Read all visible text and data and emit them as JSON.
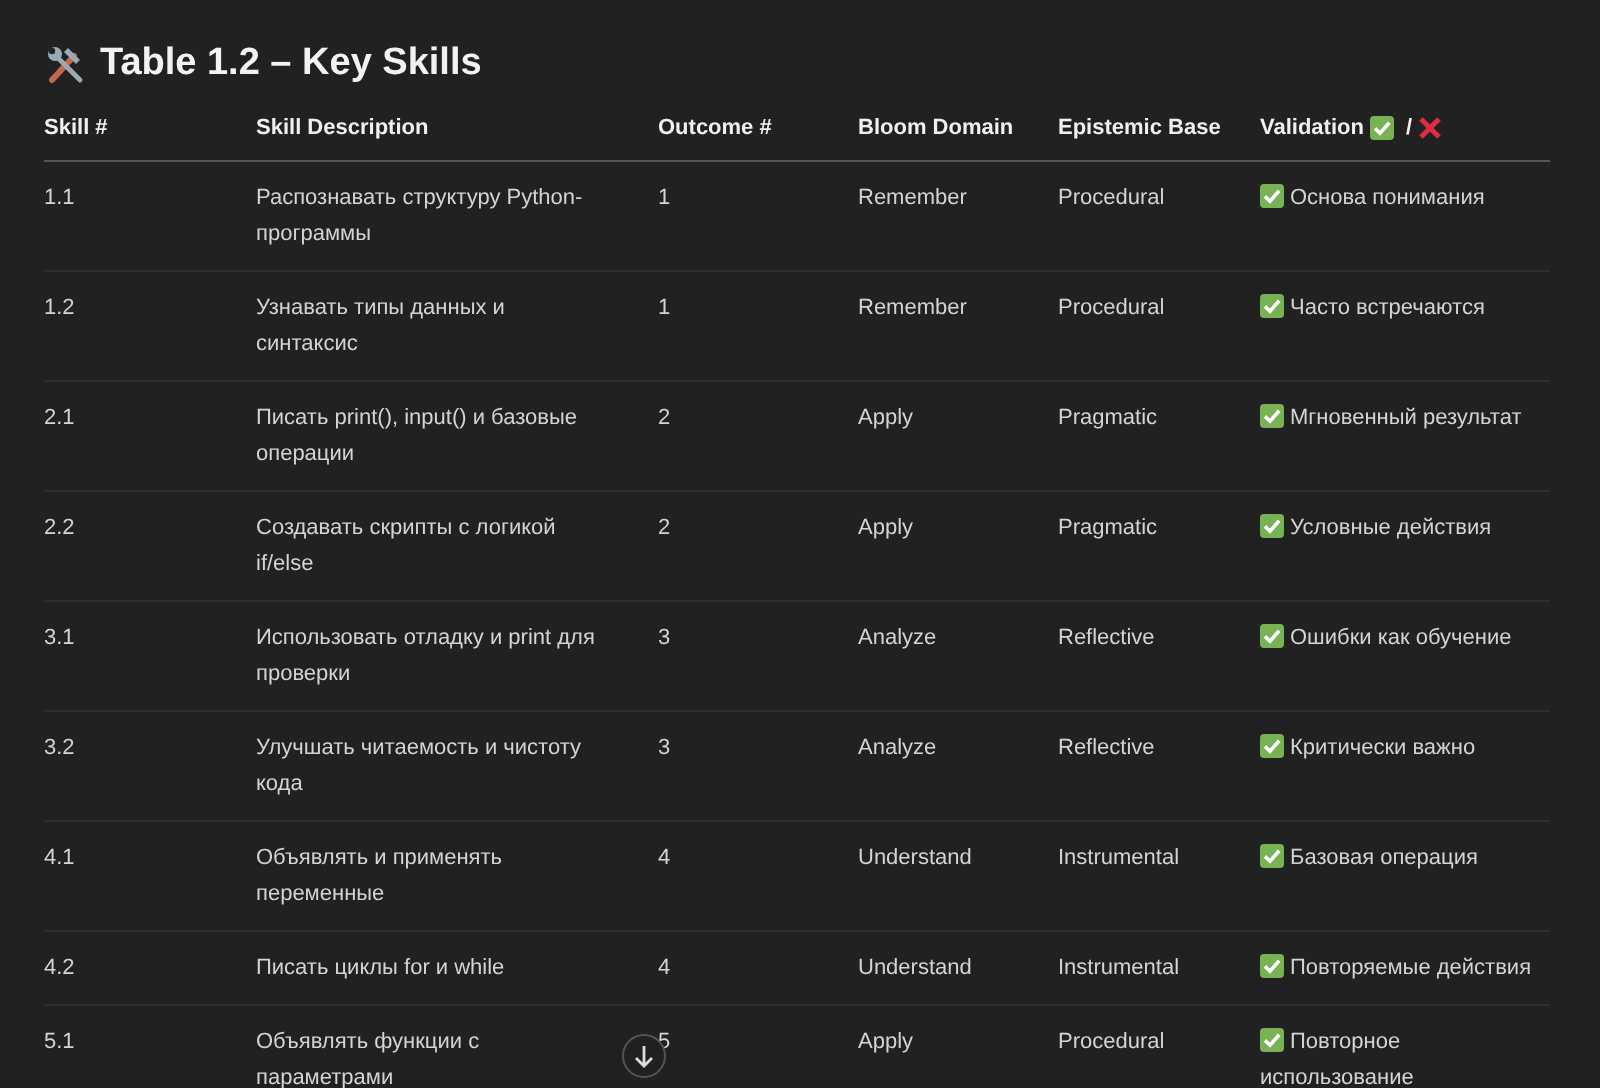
{
  "title": "Table 1.2 – Key Skills",
  "columns": [
    "Skill #",
    "Skill Description",
    "Outcome #",
    "Bloom Domain",
    "Epistemic Base",
    "Validation"
  ],
  "validation_header": {
    "separator": "/"
  },
  "rows": [
    {
      "skill": "1.1",
      "description": "Распознавать структуру Python-программы",
      "outcome": "1",
      "bloom": "Remember",
      "epistemic": "Procedural",
      "valid": true,
      "validation": "Основа понимания"
    },
    {
      "skill": "1.2",
      "description": "Узнавать типы данных и синтаксис",
      "outcome": "1",
      "bloom": "Remember",
      "epistemic": "Procedural",
      "valid": true,
      "validation": "Часто встречаются"
    },
    {
      "skill": "2.1",
      "description": "Писать print(), input() и базовые операции",
      "outcome": "2",
      "bloom": "Apply",
      "epistemic": "Pragmatic",
      "valid": true,
      "validation": "Мгновенный результат"
    },
    {
      "skill": "2.2",
      "description": "Создавать скрипты с логикой if/else",
      "outcome": "2",
      "bloom": "Apply",
      "epistemic": "Pragmatic",
      "valid": true,
      "validation": "Условные действия"
    },
    {
      "skill": "3.1",
      "description": "Использовать отладку и print для проверки",
      "outcome": "3",
      "bloom": "Analyze",
      "epistemic": "Reflective",
      "valid": true,
      "validation": "Ошибки как обучение"
    },
    {
      "skill": "3.2",
      "description": "Улучшать читаемость и чистоту кода",
      "outcome": "3",
      "bloom": "Analyze",
      "epistemic": "Reflective",
      "valid": true,
      "validation": "Критически важно"
    },
    {
      "skill": "4.1",
      "description": "Объявлять и применять переменные",
      "outcome": "4",
      "bloom": "Understand",
      "epistemic": "Instrumental",
      "valid": true,
      "validation": "Базовая операция"
    },
    {
      "skill": "4.2",
      "description": "Писать циклы for и while",
      "outcome": "4",
      "bloom": "Understand",
      "epistemic": "Instrumental",
      "valid": true,
      "validation": "Повторяемые действия"
    },
    {
      "skill": "5.1",
      "description": "Объявлять функции с параметрами",
      "outcome": "5",
      "bloom": "Apply",
      "epistemic": "Procedural",
      "valid": true,
      "validation": "Повторное использование"
    }
  ]
}
